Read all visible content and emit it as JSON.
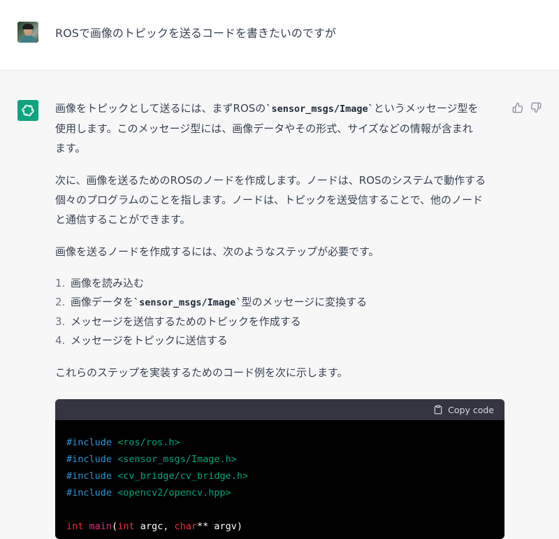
{
  "user_message": {
    "text": "ROSで画像のトピックを送るコードを書きたいのですが"
  },
  "assistant": {
    "para1": {
      "before": "画像をトピックとして送るには、まずROSの",
      "code": "`sensor_msgs/Image`",
      "after_line1": "というメッセージ型を",
      "line2": "使用します。このメッセージ型には、画像データやその形式、サイズなどの情報が含まれ",
      "line3": "ます。"
    },
    "para2": {
      "line1": "次に、画像を送るためのROSのノードを作成します。ノードは、ROSのシステムで動作する",
      "line2": "個々のプログラムのことを指します。ノードは、トピックを送受信することで、他のノード",
      "line3": "と通信することができます。"
    },
    "para3": "画像を送るノードを作成するには、次のようなステップが必要です。",
    "steps": [
      {
        "num": "1.",
        "text": "画像を読み込む"
      },
      {
        "num": "2.",
        "before": "画像データを",
        "code": "`sensor_msgs/Image`",
        "after": "型のメッセージに変換する"
      },
      {
        "num": "3.",
        "text": "メッセージを送信するためのトピックを作成する"
      },
      {
        "num": "4.",
        "text": "メッセージをトピックに送信する"
      }
    ],
    "para4": "これらのステップを実装するためのコード例を次に示します。"
  },
  "codeblock": {
    "copy_label": "Copy code",
    "includes": [
      {
        "directive": "#include",
        "header": "<ros/ros.h>"
      },
      {
        "directive": "#include",
        "header": "<sensor_msgs/Image.h>"
      },
      {
        "directive": "#include",
        "header": "<cv_bridge/cv_bridge.h>"
      },
      {
        "directive": "#include",
        "header": "<opencv2/opencv.hpp>"
      }
    ],
    "main_line": {
      "t1": "int",
      "fn": "main",
      "p1": "(",
      "t2": "int",
      "p2": " argc, ",
      "t3": "char",
      "p3": "** argv)"
    }
  },
  "colors": {
    "accent": "#10a37f",
    "code_keyword": "#2e95d3",
    "code_header": "#00a67d",
    "code_type": "#f22c3d",
    "code_function": "#df3079"
  },
  "icons": [
    "user-avatar",
    "chatgpt-logo-icon",
    "thumbs-up-icon",
    "thumbs-down-icon",
    "clipboard-icon"
  ]
}
